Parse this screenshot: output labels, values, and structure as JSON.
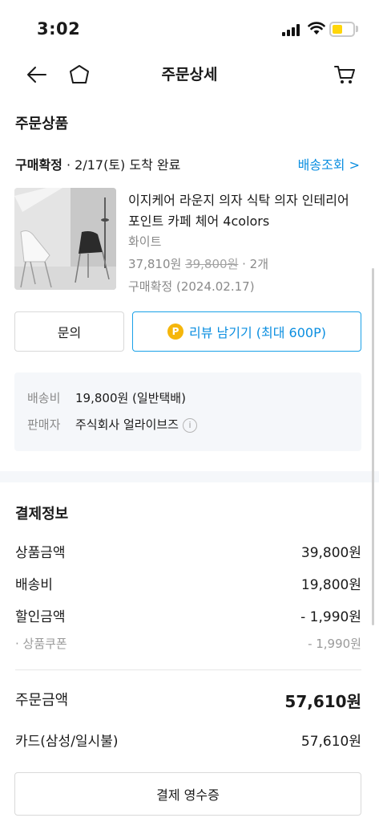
{
  "status_bar": {
    "time": "3:02"
  },
  "nav": {
    "title": "주문상세"
  },
  "order_items": {
    "section_title": "주문상품",
    "status_label": "구매확정",
    "status_detail": " · 2/17(토) 도착 완료",
    "tracking_link": "배송조회 >",
    "product": {
      "name": "이지케어 라운지 의자 식탁 의자 인테리어 포인트 카페 체어 4colors",
      "option": "화이트",
      "price": "37,810원",
      "original_price": "39,800원",
      "quantity": " · 2개",
      "confirm_text": "구매확정 (2024.02.17)"
    },
    "buttons": {
      "inquiry": "문의",
      "review_badge": "P",
      "review": "리뷰 남기기 (최대 600P)"
    },
    "info": {
      "shipping_label": "배송비",
      "shipping_value": "19,800원 (일반택배)",
      "seller_label": "판매자",
      "seller_value": "주식회사 얼라이브즈",
      "info_icon": "i"
    }
  },
  "payment": {
    "section_title": "결제정보",
    "rows": [
      {
        "label": "상품금액",
        "value": "39,800원"
      },
      {
        "label": "배송비",
        "value": "19,800원"
      },
      {
        "label": "할인금액",
        "value": "- 1,990원"
      }
    ],
    "coupon": {
      "label": "· 상품쿠폰",
      "value": "- 1,990원"
    },
    "total": {
      "label": "주문금액",
      "value": "57,610원"
    },
    "method": {
      "label": "카드(삼성/일시불)",
      "value": "57,610원"
    },
    "receipt_button": "결제 영수증"
  },
  "colors": {
    "accent": "#0a8ee0",
    "point": "#f5b60b",
    "battery": "#ffd60a"
  },
  "icons": [
    "back-arrow-icon",
    "home-icon",
    "cart-icon",
    "chevron-right-icon",
    "info-icon",
    "signal-icon",
    "wifi-icon",
    "battery-icon"
  ]
}
